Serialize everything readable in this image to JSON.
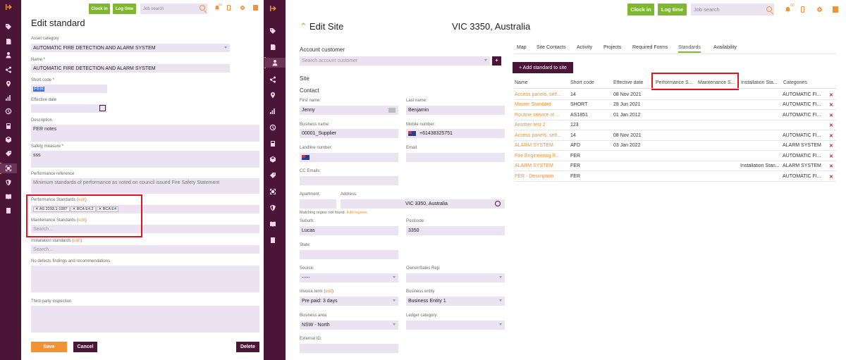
{
  "left_panel": {
    "title": "Edit standard",
    "asset_category_label": "Asset category",
    "asset_category": "AUTOMATIC FIRE DETECTION AND ALARM SYSTEM",
    "name_label": "Name *",
    "name": "AUTOMATIC FIRE DETECTION AND ALARM SYSTEM",
    "short_code_label": "Short code *",
    "short_code": "FER",
    "effective_date_label": "Effective date",
    "description_label": "Description",
    "description": "FER notes",
    "safety_measure_label": "Safety measure *",
    "safety_measure": "sss",
    "performance_reference_label": "Performance reference",
    "performance_reference": "Minimum standards of performance as noted on council issued Fire Safety Statement",
    "performance_standards_label": "Performance Standards (",
    "edit_link": "edit",
    "close_paren": ")",
    "performance_chips": [
      "AS 2293.1-1987",
      "BCA E4.2",
      "BCA E4"
    ],
    "maintenance_standards_label": "Maintenance Standards (",
    "maintenance_placeholder": "Search...",
    "installation_standards_label": "Installation standards (",
    "installation_placeholder": "Search...",
    "no_defects_label": "No defects findings and recommendations",
    "third_party_label": "Third party inspection",
    "save_label": "Save",
    "cancel_label": "Cancel",
    "delete_label": "Delete"
  },
  "header": {
    "clock_in": "Clock in",
    "log_time": "Log time",
    "job_search_placeholder": "Job search",
    "notif_count": "60"
  },
  "site": {
    "title": "Edit Site",
    "location_title": "VIC 3350, Australia",
    "account_customer_label": "Account customer",
    "account_customer_placeholder": "Search account customer",
    "add_btn": "+",
    "site_heading": "Site",
    "contact_heading": "Contact",
    "first_name_label": "First name:",
    "first_name": "Jenny",
    "last_name_label": "Last name:",
    "last_name": "Benjamin",
    "business_name_label": "Business name:",
    "business_name": "00001_Supplier",
    "mobile_label": "Mobile number:",
    "mobile": "+61438325751",
    "landline_label": "Landline number:",
    "email_label": "Email:",
    "cc_label": "CC Emails:",
    "apartment_label": "Apartment:",
    "address_label": "Address:",
    "address": "VIC 3350, Australia",
    "region_note": "Matching region not found.",
    "edit_regions": "Edit regions",
    "suburb_label": "Suburb:",
    "suburb": "Lucas",
    "postcode_label": "Postcode:",
    "postcode": "3350",
    "state_label": "State:",
    "source_label": "Source:",
    "source": "-----",
    "owner_label": "Owner/Sales Rep:",
    "invoice_term_label": "Invoice term (",
    "invoice_edit": "edit",
    "invoice_close": ")",
    "invoice_term": "Pre paid: 3 days",
    "business_entity_label": "Business entity",
    "business_entity": "Business Entity 1",
    "business_area_label": "Business area",
    "business_area": "NSW - North",
    "ledger_label": "Ledger category:",
    "external_id_label": "External ID:"
  },
  "tabs": [
    "Map",
    "Site Contacts",
    "Activity",
    "Projects",
    "Required Forms",
    "Standards",
    "Availability"
  ],
  "add_standard_label": "+ Add standard to site",
  "table": {
    "headers": [
      "Name",
      "Short code",
      "Effective date",
      "Performance S...",
      "Maintenance S...",
      "Installation Sta...",
      "Categories"
    ],
    "rows": [
      {
        "name": "Access panels, self...",
        "code": "14",
        "date": "08 Nov 2021",
        "inst": "",
        "cat": "AUTOMATIC FI..."
      },
      {
        "name": "Master Standard",
        "code": "SHORT",
        "date": "28 Jun 2021",
        "inst": "",
        "cat": "AUTOMATIC FI..."
      },
      {
        "name": "Routine service of ...",
        "code": "AS1851",
        "date": "01 Jan 2012",
        "inst": "",
        "cat": "AUTOMATIC FI..."
      },
      {
        "name": "Another test 2",
        "code": "123",
        "date": "",
        "inst": "",
        "cat": ""
      },
      {
        "name": "Access panels, self...",
        "code": "14",
        "date": "08 Nov 2021",
        "inst": "",
        "cat": "AUTOMATIC FI..."
      },
      {
        "name": "ALARM SYSTEM",
        "code": "AFD",
        "date": "03 Jan 2022",
        "inst": "",
        "cat": "ALARM SYSTEM"
      },
      {
        "name": "Fire Engineering R...",
        "code": "FER",
        "date": "",
        "inst": "",
        "cat": "AUTOMATIC FI..."
      },
      {
        "name": "ALARM SYSTEM",
        "code": "FER",
        "date": "",
        "inst": "Installation Stan...",
        "cat": "ALARM SYSTEM"
      },
      {
        "name": "FER - Description",
        "code": "FER",
        "date": "",
        "inst": "",
        "cat": "AUTOMATIC FI..."
      }
    ]
  },
  "colors": {
    "sidebar": "#4b1538",
    "accent": "#f29232",
    "green": "#7fb82e",
    "purple": "#4b1538",
    "field": "#ebe3f1",
    "highlight": "#e0141e"
  }
}
